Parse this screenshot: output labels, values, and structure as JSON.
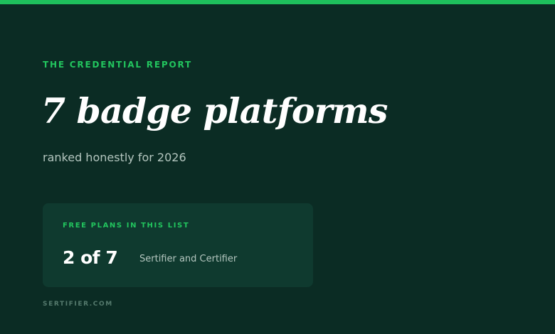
{
  "eyebrow": "THE CREDENTIAL REPORT",
  "headline": "7 badge platforms",
  "subhead": "ranked honestly for 2026",
  "card": {
    "label": "FREE PLANS IN THIS LIST",
    "stat": "2 of 7",
    "detail": "Sertifier and Certifier"
  },
  "footer": "SERTIFIER.COM",
  "colors": {
    "background": "#0b2c24",
    "accent": "#1ec05c",
    "card": "#0f3a2f"
  }
}
